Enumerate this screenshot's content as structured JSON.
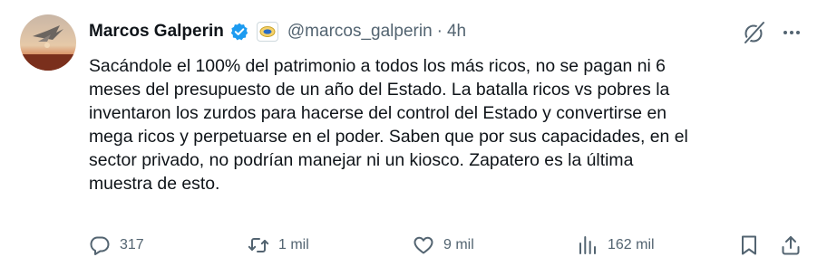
{
  "author": {
    "name": "Marcos Galperin",
    "handle": "@marcos_galperin",
    "time": "4h",
    "separator": "·"
  },
  "tweet": {
    "text": "Sacándole el 100% del patrimonio a todos los más ricos, no se pagan ni 6\nmeses del presupuesto de un año del Estado. La batalla ricos vs pobres la\ninventaron los zurdos para hacerse del control del Estado y convertirse en\nmega ricos y perpetuarse en el poder. Saben que por sus capacidades, en el\nsector privado, no podrían manejar ni un kiosco. Zapatero es la última\nmuestra de esto."
  },
  "actions": {
    "replies": "317",
    "retweets": "1 mil",
    "likes": "9 mil",
    "views": "162 mil"
  },
  "icons": {
    "avatar": "avatar-image",
    "verified": "verified-badge-icon",
    "affiliate": "affiliate-badge-icon",
    "grok": "grok-icon",
    "more": "more-icon",
    "reply": "reply-icon",
    "retweet": "retweet-icon",
    "like": "heart-icon",
    "views": "views-icon",
    "bookmark": "bookmark-icon",
    "share": "share-icon"
  },
  "colors": {
    "text": "#0f1419",
    "secondary": "#536471",
    "verified": "#1d9bf0"
  }
}
